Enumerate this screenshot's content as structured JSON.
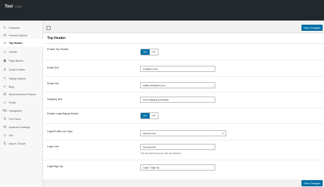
{
  "app": {
    "name": "Tovi",
    "version": "1.0.6"
  },
  "sidebar": {
    "items": [
      {
        "label": "Preloader",
        "icon": "refresh-icon"
      },
      {
        "label": "General Options",
        "icon": "gear-icon"
      },
      {
        "label": "Top Header",
        "icon": "header-icon",
        "active": true
      },
      {
        "label": "Header",
        "icon": "header-icon"
      },
      {
        "label": "Page Banner",
        "icon": "image-icon"
      },
      {
        "label": "Social Profiles",
        "icon": "share-icon"
      },
      {
        "label": "Styling Options",
        "icon": "brush-icon"
      },
      {
        "label": "Blog",
        "icon": "pencil-icon"
      },
      {
        "label": "WooCommerce Product",
        "icon": "cart-icon"
      },
      {
        "label": "Footer",
        "icon": "footer-icon"
      },
      {
        "label": "Typography",
        "icon": "typography-icon"
      },
      {
        "label": "Font Sizes",
        "icon": "font-size-icon"
      },
      {
        "label": "Advanced Settings",
        "icon": "wrench-icon"
      },
      {
        "label": "404",
        "icon": "warning-icon"
      },
      {
        "label": "Import / Export",
        "icon": "import-export-icon"
      }
    ]
  },
  "toolbar": {
    "save_label": "Save Changes"
  },
  "section": {
    "title": "Top Header"
  },
  "fields": {
    "enable_top_header": {
      "label": "Enable Top Header",
      "on": "On",
      "off": "Off"
    },
    "email_text": {
      "label": "Email Text",
      "value": "info@tovi.com"
    },
    "email_link": {
      "label": "Email Link",
      "value": "mailto:info@tovi.com"
    },
    "shipping_text": {
      "label": "Shipping Text",
      "value": "Free shipping worldwide"
    },
    "enable_login": {
      "label": "Enable Login/Signup Button",
      "on": "On",
      "off": "Off"
    },
    "login_link_type": {
      "label": "Login/Profile Link Type",
      "value": "Internal Link"
    },
    "login_link": {
      "label": "Login Link",
      "value": "my-account/",
      "hint": "This link work from your site not directory"
    },
    "login_signup": {
      "label": "Login/Sign Up",
      "value": "Login / Sign Up"
    }
  },
  "footer": {
    "save_label": "Save Changes"
  }
}
